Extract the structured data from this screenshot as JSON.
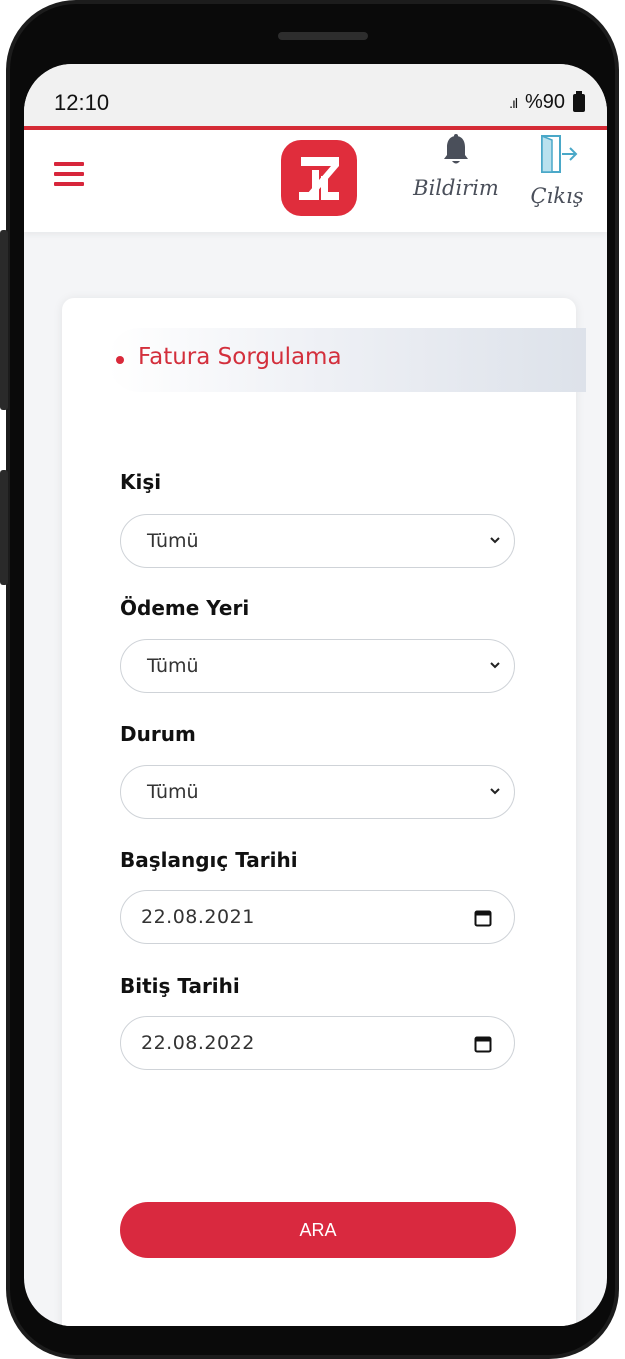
{
  "status_bar": {
    "time": "12:10",
    "signal": ".ıl",
    "battery": "%90"
  },
  "header": {
    "menu_icon": "hamburger-menu-icon",
    "logo_icon": "zt-logo",
    "notification": {
      "icon": "bell-icon",
      "label": "Bildirim"
    },
    "logout": {
      "icon": "door-exit-icon",
      "label": "Çıkış"
    }
  },
  "page": {
    "section_title": "Fatura Sorgulama"
  },
  "form": {
    "person": {
      "label": "Kişi",
      "value": "Tümü"
    },
    "payment_place": {
      "label": "Ödeme Yeri",
      "value": "Tümü"
    },
    "status": {
      "label": "Durum",
      "value": "Tümü"
    },
    "start_date": {
      "label": "Başlangıç Tarihi",
      "value": "22.08.2021"
    },
    "end_date": {
      "label": "Bitiş Tarihi",
      "value": "22.08.2022"
    },
    "search_button": "ARA"
  },
  "colors": {
    "accent": "#d9293f",
    "status_line": "#d52b36",
    "background": "#f4f5f7"
  }
}
